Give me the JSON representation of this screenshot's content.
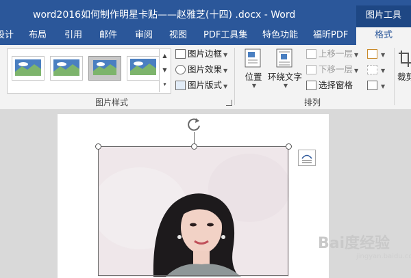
{
  "window": {
    "title": "word2016如何制作明星卡贴——赵雅芝(十四) .docx - Word",
    "context_tab_header": "图片工具"
  },
  "ribbon_tabs": [
    {
      "label": "设计"
    },
    {
      "label": "布局"
    },
    {
      "label": "引用"
    },
    {
      "label": "邮件"
    },
    {
      "label": "审阅"
    },
    {
      "label": "视图"
    },
    {
      "label": "PDF工具集"
    },
    {
      "label": "特色功能"
    },
    {
      "label": "福昕PDF"
    },
    {
      "label": "格式",
      "active": true
    }
  ],
  "groups": {
    "picture_styles": {
      "label": "图片样式",
      "styles_count_visible": 4,
      "commands": [
        {
          "label": "图片边框",
          "icon": "picture-border-icon"
        },
        {
          "label": "图片效果",
          "icon": "picture-effects-icon"
        },
        {
          "label": "图片版式",
          "icon": "picture-layout-icon"
        }
      ]
    },
    "arrange": {
      "label": "排列",
      "position_label": "位置",
      "wrap_text_label": "环绕文字",
      "commands": [
        {
          "label": "上移一层",
          "icon": "bring-forward-icon",
          "enabled": false
        },
        {
          "label": "下移一层",
          "icon": "send-backward-icon",
          "enabled": false
        },
        {
          "label": "选择窗格",
          "icon": "selection-pane-icon",
          "enabled": true
        }
      ]
    },
    "size": {
      "crop_label_partial": "裁剪"
    }
  },
  "colors": {
    "word_blue": "#2b579a",
    "ribbon_bg": "#f3f3f3",
    "canvas_bg": "#d9d9d9"
  },
  "watermark": {
    "text": "Bai度经验",
    "url": "jingyan.baidu.com"
  }
}
